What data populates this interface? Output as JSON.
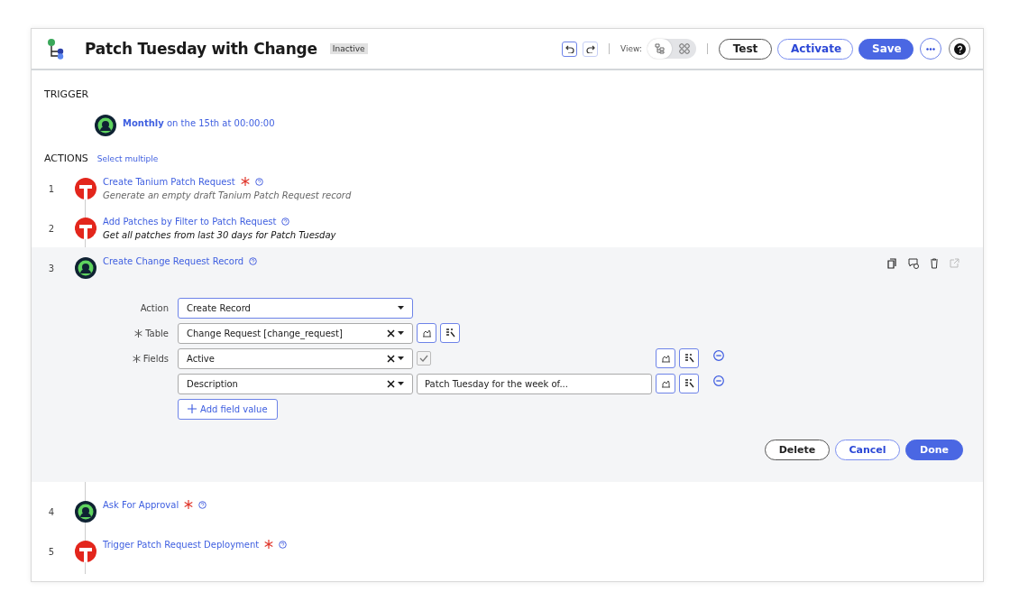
{
  "header": {
    "title": "Patch Tuesday with Change",
    "status": "Inactive",
    "view_label": "View:",
    "view_options": [
      {
        "kind": "tree",
        "selected": true
      },
      {
        "kind": "grid",
        "selected": false
      }
    ],
    "buttons": [
      {
        "label": "Test",
        "kind": "outline"
      },
      {
        "label": "Activate",
        "kind": "secondary"
      },
      {
        "label": "Save",
        "kind": "primary"
      }
    ]
  },
  "trigger": {
    "heading": "TRIGGER",
    "frequency": "Monthly",
    "schedule": "on the 15th at 00:00:00"
  },
  "actions_heading": "ACTIONS",
  "select_multiple": "Select multiple",
  "actions": [
    {
      "number": "1",
      "kind": "tanium",
      "title": "Create Tanium Patch Request",
      "required": true,
      "description": "Generate an empty draft Tanium Patch Request record",
      "description_muted": true,
      "expanded": false
    },
    {
      "number": "2",
      "kind": "tanium",
      "title": "Add Patches by Filter to Patch Request",
      "required": false,
      "description": "Get all patches from last 30 days for Patch Tuesday",
      "description_muted": false,
      "expanded": false
    },
    {
      "number": "3",
      "kind": "servicenow",
      "title": "Create Change Request Record",
      "required": false,
      "expanded": true
    },
    {
      "number": "4",
      "kind": "servicenow",
      "title": "Ask For Approval",
      "required": true,
      "expanded": false
    },
    {
      "number": "5",
      "kind": "tanium",
      "title": "Trigger Patch Request Deployment",
      "required": true,
      "expanded": false
    }
  ],
  "form": {
    "action_label": "Action",
    "action_value": "Create Record",
    "table_label": "Table",
    "table_value": "Change Request [change_request]",
    "fields_label": "Fields",
    "fields": [
      {
        "name": "Active",
        "kind": "checkbox",
        "checked": true
      },
      {
        "name": "Description",
        "kind": "text",
        "value": "Patch Tuesday for the week of..."
      }
    ],
    "add_label": "Add field value",
    "buttons": [
      {
        "label": "Delete",
        "kind": "outline"
      },
      {
        "label": "Cancel",
        "kind": "secondary"
      },
      {
        "label": "Done",
        "kind": "primary"
      }
    ]
  }
}
